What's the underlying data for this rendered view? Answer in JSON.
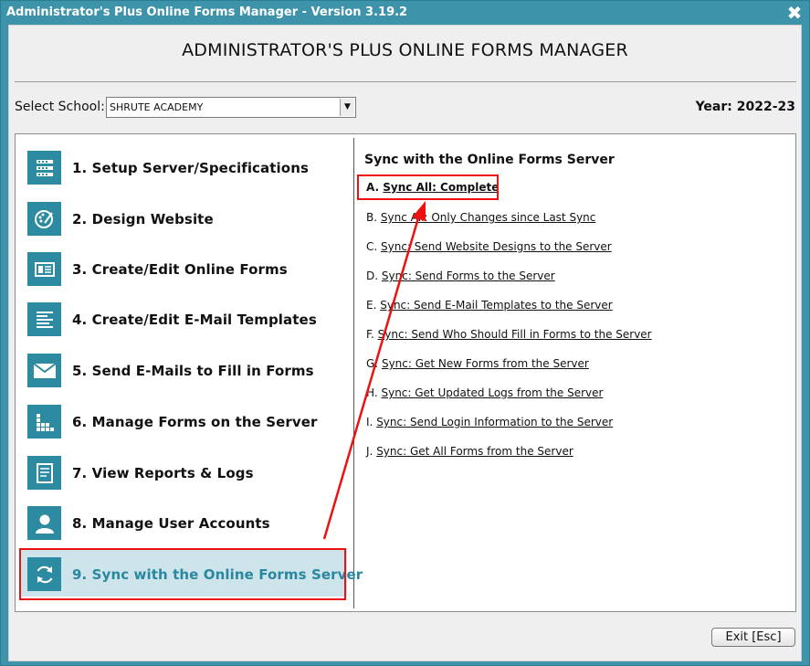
{
  "window": {
    "title": "Administrator's Plus Online Forms Manager - Version 3.19.2",
    "close_glyph": "✖"
  },
  "header": {
    "title": "ADMINISTRATOR'S PLUS ONLINE FORMS MANAGER"
  },
  "school": {
    "label": "Select School:",
    "value": "SHRUTE ACADEMY"
  },
  "year": {
    "label": "Year: 2022-23"
  },
  "menu": [
    {
      "label": "1. Setup Server/Specifications",
      "icon": "server-icon"
    },
    {
      "label": "2. Design Website",
      "icon": "palette-icon"
    },
    {
      "label": "3. Create/Edit Online Forms",
      "icon": "form-icon"
    },
    {
      "label": "4. Create/Edit E-Mail Templates",
      "icon": "text-lines-icon"
    },
    {
      "label": "5. Send E-Mails to Fill in Forms",
      "icon": "envelope-icon"
    },
    {
      "label": "6. Manage Forms on the Server",
      "icon": "grid-icon"
    },
    {
      "label": "7. View Reports & Logs",
      "icon": "report-icon"
    },
    {
      "label": "8. Manage User Accounts",
      "icon": "user-icon"
    },
    {
      "label": "9. Sync with the Online Forms Server",
      "icon": "sync-icon",
      "active": true
    }
  ],
  "sync": {
    "heading": "Sync with the Online Forms Server",
    "links": [
      {
        "prefix": "A.",
        "label": "Sync All: Complete"
      },
      {
        "prefix": "B.",
        "label": "Sync All: Only Changes since Last Sync"
      },
      {
        "prefix": "C.",
        "label": "Sync: Send Website Designs to the Server"
      },
      {
        "prefix": "D.",
        "label": "Sync: Send Forms to the Server"
      },
      {
        "prefix": "E.",
        "label": "Sync: Send E-Mail Templates to the Server"
      },
      {
        "prefix": "F.",
        "label": "Sync: Send Who Should Fill in Forms to the Server"
      },
      {
        "prefix": "G.",
        "label": "Sync: Get New Forms from the Server"
      },
      {
        "prefix": "H.",
        "label": "Sync: Get Updated Logs from the Server"
      },
      {
        "prefix": "I.",
        "label": "Sync: Send Login Information to the Server"
      },
      {
        "prefix": "J.",
        "label": "Sync: Get All Forms from the Server"
      }
    ]
  },
  "footer": {
    "exit_label": "Exit [Esc]"
  },
  "colors": {
    "frame": "#3d93a9",
    "accent": "#2c8ba1",
    "highlight": "#e11111"
  }
}
